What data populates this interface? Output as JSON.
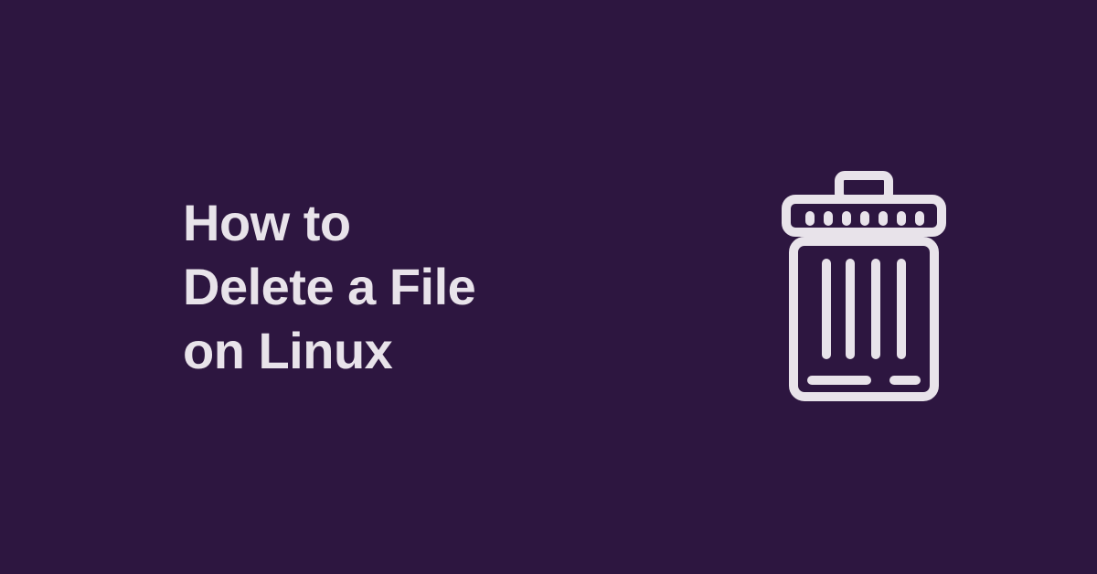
{
  "title_line1": "How to",
  "title_line2": "Delete a File",
  "title_line3": "on Linux",
  "icon_name": "trash-icon",
  "colors": {
    "background": "#2d1640",
    "foreground": "#e8e3ea"
  }
}
